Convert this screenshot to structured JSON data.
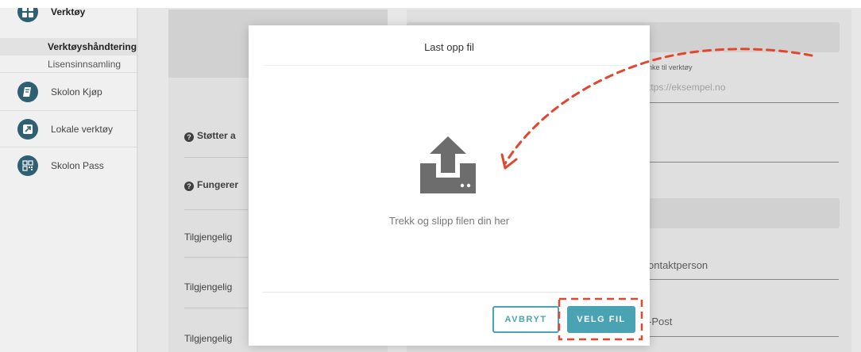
{
  "sidebar": {
    "top_item": {
      "label": "Verktøy",
      "icon": "grid-icon"
    },
    "subitems": [
      {
        "label": "Verktøyshåndtering"
      },
      {
        "label": "Lisensinnsamling"
      }
    ],
    "items": [
      {
        "label": "Skolon Kjøp",
        "icon": "book-icon"
      },
      {
        "label": "Lokale verktøy",
        "icon": "external-link-icon"
      },
      {
        "label": "Skolon Pass",
        "icon": "qr-code-icon"
      }
    ]
  },
  "background": {
    "rows": [
      {
        "label": "Støtter a",
        "help": "?"
      },
      {
        "label": "Fungerer",
        "help": "?"
      },
      {
        "label": "Tilgjengelig"
      },
      {
        "label": "Tilgjengelig"
      },
      {
        "label": "Tilgjengelig"
      }
    ],
    "right": {
      "link_label": "nke til verktøy",
      "link_placeholder": "ttps://eksempel.no",
      "contact_label": "ontaktperson",
      "email_label": "-Post"
    }
  },
  "modal": {
    "title": "Last opp fil",
    "drop_text": "Trekk og slipp filen din her",
    "cancel_label": "AVBRYT",
    "select_label": "VELG FIL",
    "accent_color": "#4aa3b3",
    "icon": "upload-icon"
  },
  "annotation": {
    "color": "#e2462e"
  }
}
